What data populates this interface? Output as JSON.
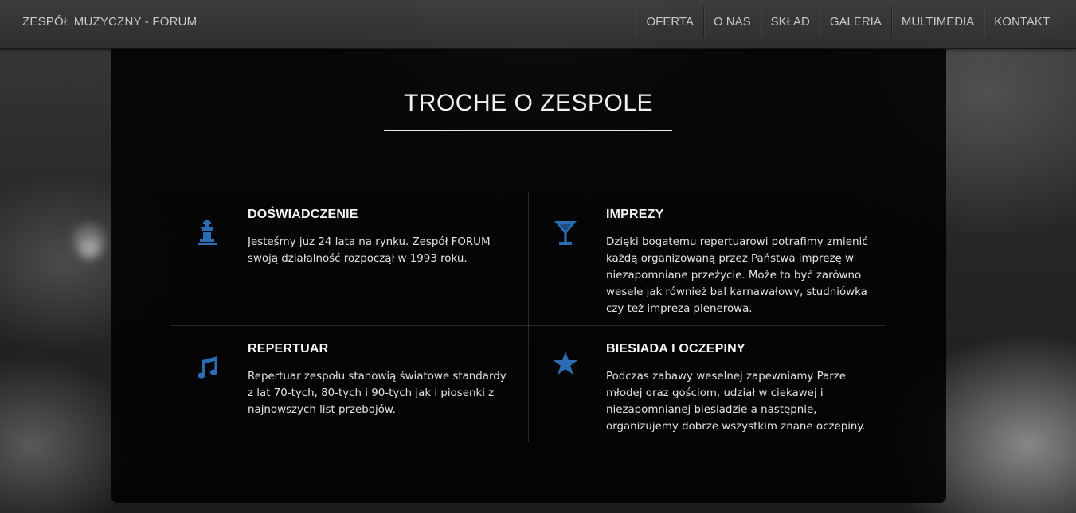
{
  "header": {
    "brand": "ZESPÓŁ MUZYCZNY - FORUM",
    "nav": [
      "OFERTA",
      "O NAS",
      "SKŁAD",
      "GALERIA",
      "MULTIMEDIA",
      "KONTAKT"
    ]
  },
  "section": {
    "title": "TROCHE O ZESPOLE"
  },
  "features": [
    {
      "title": "DOŚWIADCZENIE",
      "text": "Jesteśmy juz 24 lata na rynku. Zespół FORUM swoją działalność rozpoczął w 1993 roku.",
      "icon": "chess-king-icon"
    },
    {
      "title": "IMPREZY",
      "text": "Dzięki bogatemu repertuarowi potrafimy zmienić każdą organizowaną przez Państwa imprezę w niezapomniane przeżycie. Może to być zarówno wesele jak również bal karnawałowy, studniówka czy też impreza plenerowa.",
      "icon": "cocktail-glass-icon"
    },
    {
      "title": "REPERTUAR",
      "text": "Repertuar zespołu stanowią światowe standardy z lat 70-tych, 80-tych i 90-tych jak i piosenki z najnowszych list przebojów.",
      "icon": "music-note-icon"
    },
    {
      "title": "BIESIADA I OCZEPINY",
      "text": "Podczas zabawy weselnej zapewniamy Parze młodej oraz gościom, udział w ciekawej i niezapomnianej biesiadzie a następnie, organizujemy dobrze wszystkim znane oczepiny.",
      "icon": "star-icon"
    }
  ],
  "colors": {
    "accent": "#2a6db5",
    "panel": "#000000",
    "nav_text": "#c9c9c9"
  }
}
